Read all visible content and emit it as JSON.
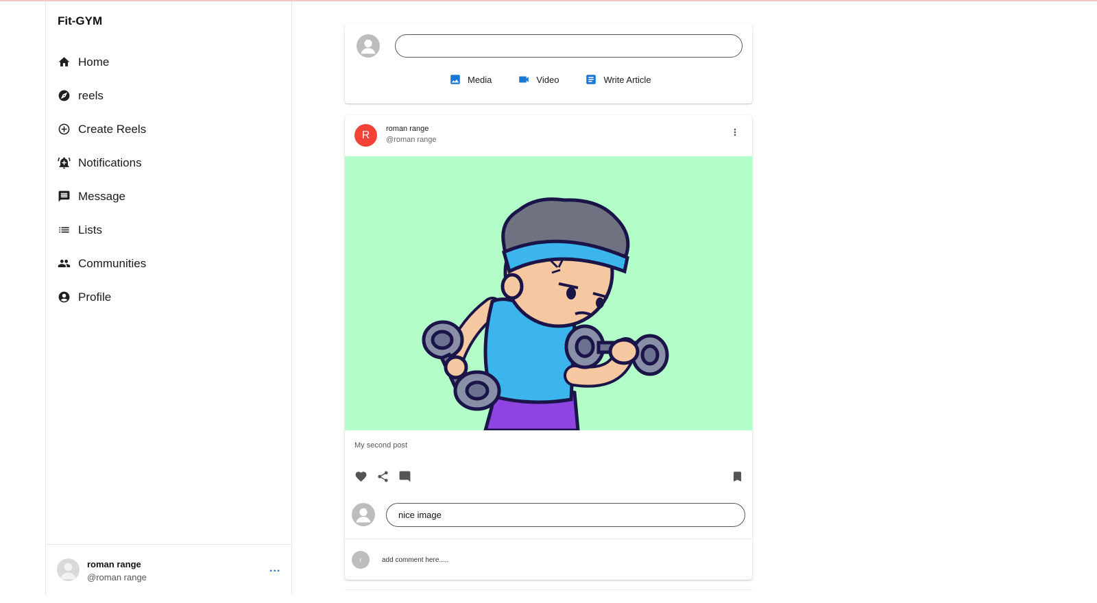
{
  "brand": "Fit-GYM",
  "nav": [
    {
      "label": "Home",
      "icon": "home-icon"
    },
    {
      "label": "reels",
      "icon": "compass-icon"
    },
    {
      "label": "Create Reels",
      "icon": "add-circle-icon"
    },
    {
      "label": "Notifications",
      "icon": "bell-icon"
    },
    {
      "label": "Message",
      "icon": "message-icon"
    },
    {
      "label": "Lists",
      "icon": "list-icon"
    },
    {
      "label": "Communities",
      "icon": "people-icon"
    },
    {
      "label": "Profile",
      "icon": "account-circle-icon"
    }
  ],
  "sidebar_user": {
    "name": "roman range",
    "handle": "@roman range",
    "more": "..."
  },
  "composer": {
    "input_value": "",
    "actions": [
      {
        "label": "Media",
        "icon": "image-icon"
      },
      {
        "label": "Video",
        "icon": "videocam-icon"
      },
      {
        "label": "Write Article",
        "icon": "article-icon"
      }
    ]
  },
  "post": {
    "avatar_letter": "R",
    "author": "roman range",
    "handle": "@roman range",
    "caption": "My second post",
    "image_background": "#b3fdc8",
    "comment_input_value": "nice image",
    "comments": [
      {
        "avatar_letter": "r",
        "text": "add comment here....."
      }
    ]
  },
  "colors": {
    "accent": "#1976d2",
    "avatar_red": "#f44336"
  }
}
